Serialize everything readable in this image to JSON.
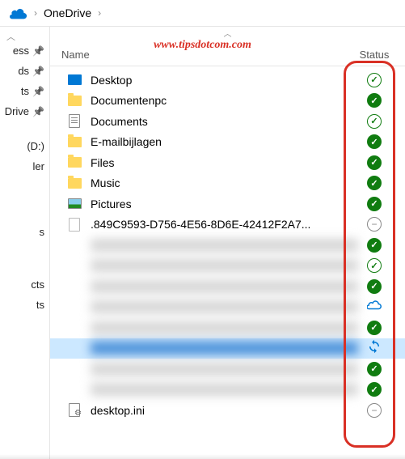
{
  "breadcrumb": {
    "location": "OneDrive"
  },
  "watermark": "www.tipsdotcom.com",
  "columns": {
    "name": "Name",
    "status": "Status"
  },
  "sidebar": {
    "items": [
      {
        "label": "ess",
        "pinned": true
      },
      {
        "label": "ds",
        "pinned": true
      },
      {
        "label": "ts",
        "pinned": true
      },
      {
        "label": "Drive",
        "pinned": true
      },
      {
        "label": "(D:)",
        "pinned": false
      },
      {
        "label": "ler",
        "pinned": false
      },
      {
        "label": "s",
        "pinned": false
      },
      {
        "label": "cts",
        "pinned": false
      },
      {
        "label": "ts",
        "pinned": false
      }
    ]
  },
  "files": [
    {
      "name": "Desktop",
      "icon": "desktop",
      "status": "synced-outline"
    },
    {
      "name": "Documentenpc",
      "icon": "folder",
      "status": "synced"
    },
    {
      "name": "Documents",
      "icon": "docfile",
      "status": "synced-outline"
    },
    {
      "name": "E-mailbijlagen",
      "icon": "folder",
      "status": "synced"
    },
    {
      "name": "Files",
      "icon": "folder",
      "status": "synced"
    },
    {
      "name": "Music",
      "icon": "folder",
      "status": "synced"
    },
    {
      "name": "Pictures",
      "icon": "picfile",
      "status": "synced"
    },
    {
      "name": ".849C9593-D756-4E56-8D6E-42412F2A7...",
      "icon": "blankfile",
      "status": "excluded"
    },
    {
      "name": "hidden-1",
      "icon": "none",
      "status": "synced",
      "blurred": true
    },
    {
      "name": "hidden-2",
      "icon": "none",
      "status": "synced-outline",
      "blurred": true
    },
    {
      "name": "hidden-3",
      "icon": "none",
      "status": "synced",
      "blurred": true
    },
    {
      "name": "hidden-4",
      "icon": "none",
      "status": "cloud",
      "blurred": true
    },
    {
      "name": "hidden-5",
      "icon": "none",
      "status": "synced",
      "blurred": true
    },
    {
      "name": "hidden-6",
      "icon": "none",
      "status": "sync",
      "blurred": true,
      "selected": true
    },
    {
      "name": "hidden-7",
      "icon": "none",
      "status": "synced",
      "blurred": true
    },
    {
      "name": "hidden-8",
      "icon": "none",
      "status": "synced",
      "blurred": true
    },
    {
      "name": "desktop.ini",
      "icon": "inifile",
      "status": "excluded"
    }
  ]
}
